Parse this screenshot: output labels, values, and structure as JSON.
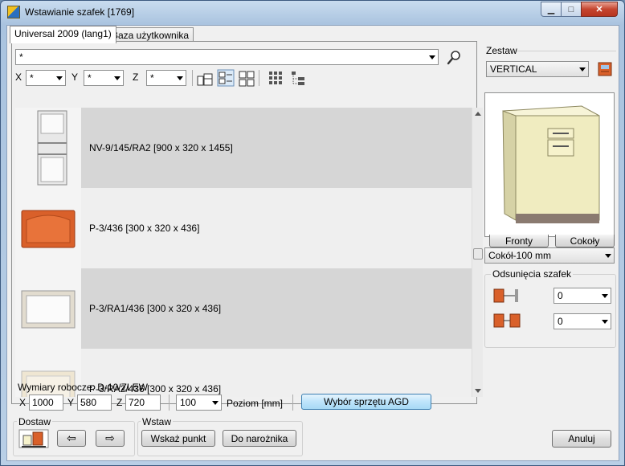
{
  "window": {
    "title": "Wstawianie szafek [1769]",
    "minimize_symbol": "▁",
    "maximize_symbol": "□",
    "close_symbol": "✕"
  },
  "tabs": [
    {
      "label": "Universal 2009 (lang1)",
      "active": true
    },
    {
      "label": "Baza użytkownika",
      "active": false
    }
  ],
  "filter": {
    "main_value": "*",
    "x_label": "X",
    "x_value": "*",
    "y_label": "Y",
    "y_value": "*",
    "z_label": "Z",
    "z_value": "*"
  },
  "items": [
    {
      "label": "NV-9/145/RA2  [900 x 320 x 1455]",
      "selected": true,
      "thumb": "tall-shelf-cabinet"
    },
    {
      "label": "P-3/436  [300 x 320 x 436]",
      "selected": false,
      "thumb": "orange-wall-cabinet"
    },
    {
      "label": "P-3/RA1/436  [300 x 320 x 436]",
      "selected": true,
      "thumb": "glass-wall-cabinet"
    },
    {
      "label": "P-3/RA2/436  [300 x 320 x 436]",
      "selected": false,
      "thumb": "frosted-wall-cabinet"
    }
  ],
  "right": {
    "zestaw_label": "Zestaw",
    "zestaw_value": "VERTICAL",
    "fronty_label": "Fronty",
    "cokoly_label": "Cokoły",
    "cokol_value": "Cokół-100 mm",
    "odsuniecia_label": "Odsunięcia szafek",
    "offset1_value": "0",
    "offset2_value": "0"
  },
  "working": {
    "label": "Wymiary robocze: D-10/ZLEW",
    "x_label": "X",
    "x_value": "1000",
    "y_label": "Y",
    "y_value": "580",
    "z_label": "Z",
    "z_value": "720",
    "level_value": "100",
    "level_label": "Poziom [mm]",
    "agd_button": "Wybór sprzętu AGD"
  },
  "dostaw": {
    "label": "Dostaw",
    "left_arrow": "⇦",
    "right_arrow": "⇨"
  },
  "wstaw": {
    "label": "Wstaw",
    "point_button": "Wskaż punkt",
    "corner_button": "Do narożnika"
  },
  "cancel_button": "Anuluj",
  "colors": {
    "selected_row": "#d6d6d6",
    "plain_row": "#efefef",
    "agd_button": "#bee4fb",
    "preview_cabinet": "#f0ecc0"
  }
}
